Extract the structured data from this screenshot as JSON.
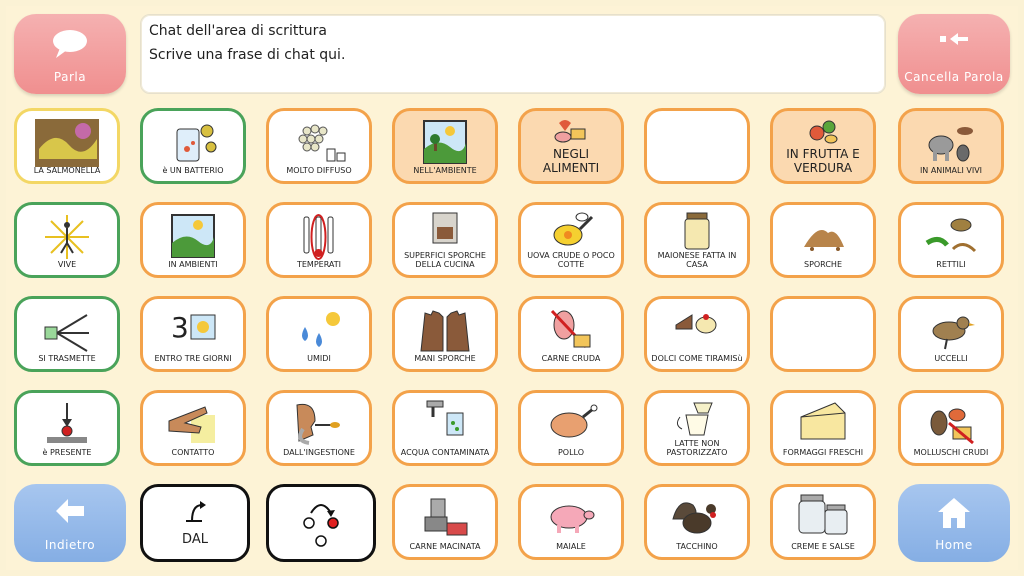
{
  "top": {
    "speak_label": "Parla",
    "clear_label": "Cancella Parola",
    "chat_title": "Chat dell'area di scrittura",
    "chat_placeholder": "Scrive una frase di chat qui."
  },
  "row1": [
    "LA SALMONELLA",
    "è UN BATTERIO",
    "MOLTO DIFFUSO",
    "NELL'AMBIENTE",
    "NEGLI ALIMENTI",
    "",
    "IN FRUTTA E VERDURA",
    "IN ANIMALI VIVI"
  ],
  "row2": [
    "VIVE",
    "IN AMBIENTI",
    "TEMPERATI",
    "SUPERFICI SPORCHE DELLA CUCINA",
    "UOVA CRUDE O POCO COTTE",
    "MAIONESE FATTA IN CASA",
    "SPORCHE",
    "RETTILI"
  ],
  "row3": [
    "SI TRASMETTE",
    "ENTRO TRE GIORNI",
    "UMIDI",
    "MANI SPORCHE",
    "CARNE CRUDA",
    "DOLCI COME TIRAMISù",
    "",
    "UCCELLI"
  ],
  "row4": [
    "è PRESENTE",
    "CONTATTO",
    "DALL'INGESTIONE",
    "ACQUA CONTAMINATA",
    "POLLO",
    "LATTE NON PASTORIZZATO",
    "FORMAGGI FRESCHI",
    "MOLLUSCHI CRUDI"
  ],
  "row5": {
    "back_label": "Indietro",
    "dal_label": "DAL",
    "minced_label": "CARNE MACINATA",
    "pig_label": "MAIALE",
    "turkey_label": "TACCHINO",
    "creams_label": "CREME E SALSE",
    "home_label": "Home"
  }
}
